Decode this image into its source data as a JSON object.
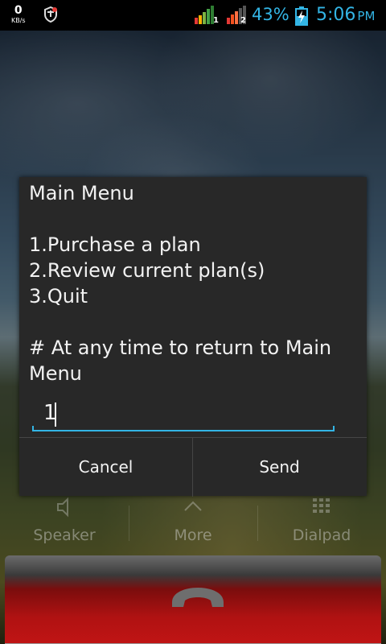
{
  "status_bar": {
    "net_speed": "0",
    "net_unit": "KB/s",
    "sim1_label": "1",
    "sim2_label": "2",
    "battery_percent": "43%",
    "time": "5:06",
    "ampm": "PM",
    "accent_color": "#33b5e5"
  },
  "dialog": {
    "message": "Main Menu\n\n1.Purchase a plan\n2.Review current plan(s)\n3.Quit\n\n# At any time to return to Main Menu",
    "input_value": "1",
    "cancel_label": "Cancel",
    "send_label": "Send"
  },
  "call_controls": {
    "speaker_label": "Speaker",
    "more_label": "More",
    "dialpad_label": "Dialpad",
    "end_call_color": "#b01212"
  }
}
